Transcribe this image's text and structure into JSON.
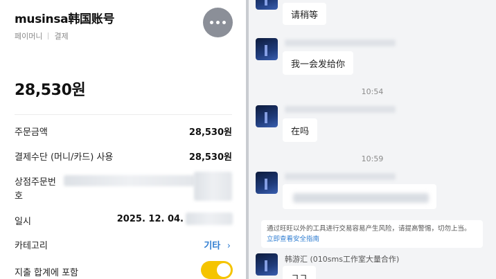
{
  "left": {
    "title": "musinsa韩国账号",
    "subtitle_left": "페이머니",
    "subtitle_right": "결제",
    "amount": "28,530원",
    "rows": [
      {
        "label": "주문금액",
        "value": "28,530원"
      },
      {
        "label": "결제수단 (머니/카드) 사용",
        "value": "28,530원"
      },
      {
        "label_line1": "상점주문번",
        "label_line2": "호",
        "value": "2⋯⋯0000000⋯"
      },
      {
        "label": "일시",
        "value": "2025. 12. 04."
      },
      {
        "label": "카테고리",
        "value": "기타"
      },
      {
        "label": "지출 합계에 포함"
      }
    ],
    "category_chevron_icon": "chevron-right-icon",
    "more_icon": "more-horizontal-icon",
    "toggle_on": true,
    "colors": {
      "toggle": "#f5c400",
      "link": "#2f7dd1",
      "more_button": "#8b8f98"
    }
  },
  "right": {
    "messages": [
      {
        "text": "请稍等"
      },
      {
        "text": "我一会发给你"
      },
      {
        "time": "10:54"
      },
      {
        "text": "在吗"
      },
      {
        "time": "10:59"
      },
      {
        "text": ""
      }
    ],
    "warning_text": "通过旺旺以外的工具进行交易容易产生风险，请提高警惕，切勿上当。",
    "warning_link": "立即查看安全指南",
    "last_sender": "韩游汇 (010sms工作室大量合作)",
    "last_message": "ㄱㄱ"
  }
}
